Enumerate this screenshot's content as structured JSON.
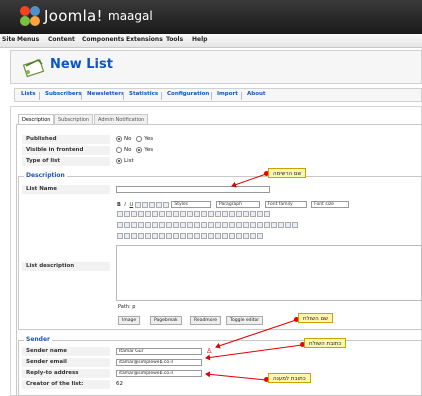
{
  "header": {
    "logo_text": "Joomla!",
    "site_name": "maagal"
  },
  "menubar": [
    "Site",
    "Menus",
    "Content",
    "Components",
    "Extensions",
    "Tools",
    "Help"
  ],
  "page_title": "New List",
  "submenu": [
    "Lists",
    "Subscribers",
    "Newsletters",
    "Statistics",
    "Configuration",
    "Import",
    "About"
  ],
  "tabs": [
    "Description",
    "Subscription",
    "Admin Notification"
  ],
  "fields": {
    "published": {
      "label": "Published",
      "options": [
        "No",
        "Yes"
      ],
      "selected": "No"
    },
    "visible": {
      "label": "Visible in frontend",
      "options": [
        "No",
        "Yes"
      ],
      "selected": "Yes"
    },
    "type": {
      "label": "Type of list",
      "options": [
        "List"
      ],
      "selected": "List"
    }
  },
  "description_legend": "Description",
  "list_name_label": "List Name",
  "list_description_label": "List description",
  "editor": {
    "styles": "Styles",
    "paragraph": "Paragraph",
    "font_family": "Font family",
    "font_size": "Font size",
    "path": "Path: p",
    "buttons": [
      "Image",
      "Pagebreak",
      "Readmore",
      "Toggle editor"
    ]
  },
  "sender": {
    "legend": "Sender",
    "name_label": "Sender name",
    "name_value": "Itamar Gur",
    "email_label": "Sender email",
    "email_value": "itamar@simpleweb.co.il",
    "reply_label": "Reply-to address",
    "reply_value": "itamar@simpleweb.co.il",
    "creator_label": "Creator of the list:",
    "creator_value": "62"
  },
  "callouts": {
    "list_name": "שם הרשימה",
    "sender_name": "שם השולח",
    "sender_email": "כתובת השולח",
    "reply_to": "כתובת למענה"
  },
  "colors": {
    "accent": "#0b55c4",
    "callout_bg": "#fdf5b2",
    "arrow": "#e00000"
  }
}
